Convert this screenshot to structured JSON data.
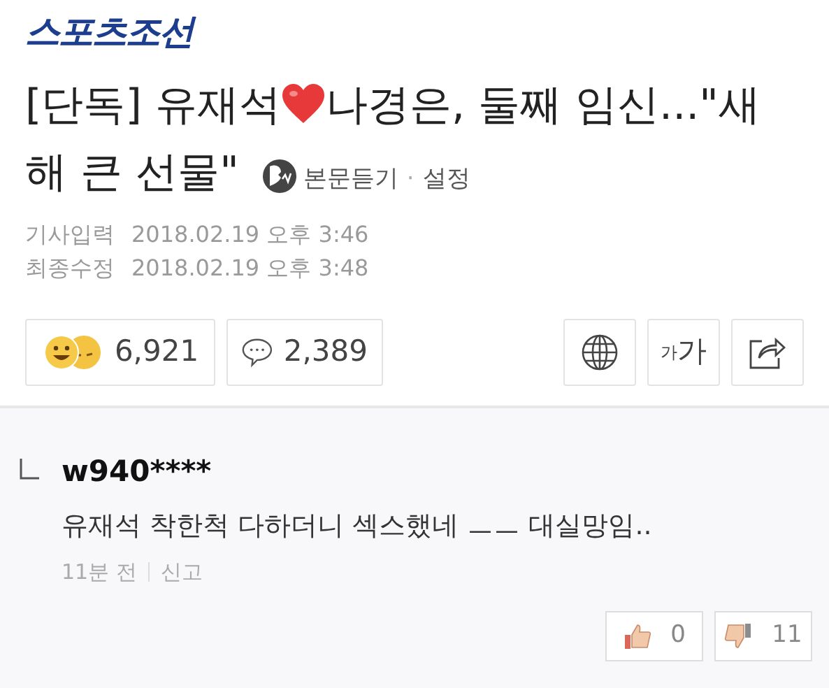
{
  "logo": "스포츠조선",
  "headline": {
    "before_icon": "[단독] 유재석",
    "after_icon": "나경은, 둘째 임신...\"새",
    "second_line": "해 큰 선물\""
  },
  "listen": {
    "label": "본문듣기",
    "separator": "·",
    "settings": "설정"
  },
  "dates": [
    {
      "label": "기사입력",
      "value": "2018.02.19 오후 3:46"
    },
    {
      "label": "최종수정",
      "value": "2018.02.19 오후 3:48"
    }
  ],
  "reactions": {
    "count": "6,921"
  },
  "comment_count": "2,389",
  "tools": [
    {
      "kind": "globe"
    },
    {
      "kind": "font",
      "small": "가",
      "large": "가"
    },
    {
      "kind": "share"
    }
  ],
  "comment": {
    "user": "w940****",
    "text": "유재석 착한척 다하더니 섹스했네 ㅡㅡ 대실망임..",
    "time": "11분 전",
    "report": "신고",
    "likes": "0",
    "dislikes": "11"
  }
}
